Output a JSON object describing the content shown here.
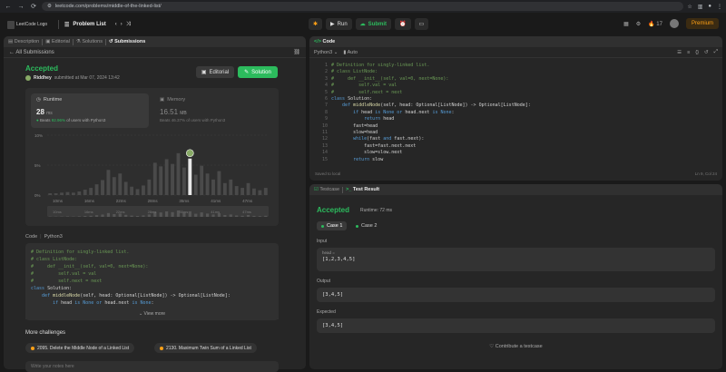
{
  "browser": {
    "url": "leetcode.com/problems/middle-of-the-linked-list/"
  },
  "topbar": {
    "logo_alt": "LeetCode Logo",
    "problem_list": "Problem List",
    "run_label": "Run",
    "submit_label": "Submit",
    "streak": "17",
    "premium": "Premium"
  },
  "left_tabs": {
    "description": "Description",
    "editorial": "Editorial",
    "solutions": "Solutions",
    "submissions": "Submissions"
  },
  "submission": {
    "back_label": "All Submissions",
    "status": "Accepted",
    "user": "Riddhey",
    "submitted_text": "submitted at Mar 07, 2024 13:42",
    "editorial_btn": "Editorial",
    "solution_btn": "Solution",
    "runtime_title": "Runtime",
    "runtime_value": "28",
    "runtime_unit": "ms",
    "runtime_beats_prefix": "Beats",
    "runtime_beats_pct": "92.96%",
    "runtime_beats_suffix": "of users with Python3",
    "memory_title": "Memory",
    "memory_value": "16.51",
    "memory_unit": "MB",
    "memory_beats": "Beats 46.37% of users with Python3"
  },
  "chart_data": {
    "type": "bar",
    "y_tick_labels": [
      "10%",
      "5%",
      "0%"
    ],
    "x_tick_labels": [
      "10ms",
      "16ms",
      "22ms",
      "28ms",
      "35ms",
      "41ms",
      "47ms"
    ],
    "values": [
      0.3,
      0.3,
      0.4,
      0.5,
      0.4,
      0.6,
      0.9,
      1.2,
      1.8,
      2.5,
      4.2,
      3.0,
      3.6,
      2.2,
      1.4,
      1.0,
      1.6,
      2.6,
      5.4,
      4.8,
      6.0,
      5.2,
      7.0,
      4.6,
      6.1,
      3.4,
      4.9,
      3.6,
      2.6,
      4.0,
      2.0,
      2.6,
      1.5,
      1.2,
      2.0,
      1.1,
      0.8,
      1.2
    ],
    "highlight_index": 24,
    "ylim": [
      0,
      10
    ]
  },
  "code_section": {
    "label": "Code",
    "language": "Python3",
    "lines": [
      "# Definition for singly-linked list.",
      "# class ListNode:",
      "#     def __init__(self, val=0, next=None):",
      "#         self.val = val",
      "#         self.next = next",
      "class Solution:",
      "    def middleNode(self, head: Optional[ListNode]) -> Optional[ListNode]:",
      "        if head is None or head.next is None:"
    ],
    "view_more": "View more"
  },
  "more_challenges": {
    "title": "More challenges",
    "items": [
      "2095. Delete the Middle Node of a Linked List",
      "2130. Maximum Twin Sum of a Linked List"
    ]
  },
  "notes_placeholder": "Write your notes here",
  "editor": {
    "title": "Code",
    "language": "Python3",
    "mode": "Auto",
    "lines": [
      "# Definition for singly-linked list.",
      "# class ListNode:",
      "#     def __init__(self, val=0, next=None):",
      "#         self.val = val",
      "#         self.next = next",
      "class Solution:",
      "    def middleNode(self, head: Optional[ListNode]) -> Optional[ListNode]:",
      "        if head is None or head.next is None:",
      "            return head",
      "        fast=head",
      "        slow=head",
      "        while(fast and fast.next):",
      "            fast=fast.next.next",
      "            slow=slow.next",
      "        return slow"
    ],
    "saved": "Saved to local",
    "cursor": "Ln 9, Col 24"
  },
  "result": {
    "testcase_tab": "Testcase",
    "result_tab": "Test Result",
    "status": "Accepted",
    "runtime": "Runtime: 72 ms",
    "case1": "Case 1",
    "case2": "Case 2",
    "input_label": "Input",
    "input_var": "head =",
    "input_value": "[1,2,3,4,5]",
    "output_label": "Output",
    "output_value": "[3,4,5]",
    "expected_label": "Expected",
    "expected_value": "[3,4,5]",
    "contribute": "Contribute a testcase"
  }
}
